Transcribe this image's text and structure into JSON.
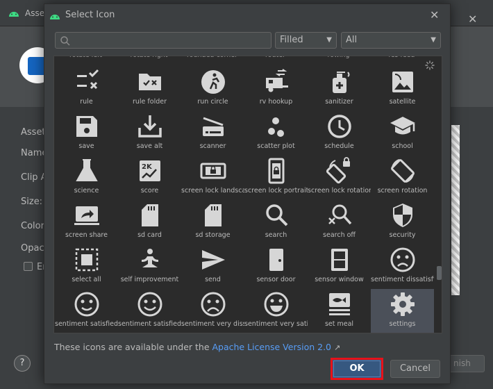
{
  "background_window": {
    "title": "Asse",
    "labels": [
      "Asset",
      "Name",
      "Clip A",
      "Size:",
      "Color:",
      "Opaci",
      "En"
    ],
    "help_label": "?",
    "finish_label": "nish"
  },
  "dialog": {
    "title": "Select Icon",
    "close_label": "✕",
    "search": {
      "value": "",
      "placeholder": ""
    },
    "style_select": {
      "value": "Filled"
    },
    "category_select": {
      "value": "All"
    },
    "partial_row": [
      "rotate left",
      "rotate right",
      "rounded corner",
      "router",
      "rowing",
      "rss feed"
    ],
    "icons": [
      {
        "name": "rule",
        "icon": "rule-icon"
      },
      {
        "name": "rule folder",
        "icon": "rule-folder-icon"
      },
      {
        "name": "run circle",
        "icon": "run-circle-icon"
      },
      {
        "name": "rv hookup",
        "icon": "rv-hookup-icon"
      },
      {
        "name": "sanitizer",
        "icon": "sanitizer-icon"
      },
      {
        "name": "satellite",
        "icon": "satellite-icon"
      },
      {
        "name": "save",
        "icon": "save-icon"
      },
      {
        "name": "save alt",
        "icon": "save-alt-icon"
      },
      {
        "name": "scanner",
        "icon": "scanner-icon"
      },
      {
        "name": "scatter plot",
        "icon": "scatter-plot-icon"
      },
      {
        "name": "schedule",
        "icon": "schedule-icon"
      },
      {
        "name": "school",
        "icon": "school-icon"
      },
      {
        "name": "science",
        "icon": "science-icon"
      },
      {
        "name": "score",
        "icon": "score-icon"
      },
      {
        "name": "screen lock landscape",
        "icon": "screen-lock-landscape-icon"
      },
      {
        "name": "screen lock portrait",
        "icon": "screen-lock-portrait-icon"
      },
      {
        "name": "screen lock rotation",
        "icon": "screen-lock-rotation-icon"
      },
      {
        "name": "screen rotation",
        "icon": "screen-rotation-icon"
      },
      {
        "name": "screen share",
        "icon": "screen-share-icon"
      },
      {
        "name": "sd card",
        "icon": "sd-card-icon"
      },
      {
        "name": "sd storage",
        "icon": "sd-storage-icon"
      },
      {
        "name": "search",
        "icon": "search-icon"
      },
      {
        "name": "search off",
        "icon": "search-off-icon"
      },
      {
        "name": "security",
        "icon": "security-icon"
      },
      {
        "name": "select all",
        "icon": "select-all-icon"
      },
      {
        "name": "self improvement",
        "icon": "self-improvement-icon"
      },
      {
        "name": "send",
        "icon": "send-icon"
      },
      {
        "name": "sensor door",
        "icon": "sensor-door-icon"
      },
      {
        "name": "sensor window",
        "icon": "sensor-window-icon"
      },
      {
        "name": "sentiment dissatisfied",
        "icon": "sentiment-dissatisfied-icon"
      },
      {
        "name": "sentiment satisfied",
        "icon": "sentiment-satisfied-icon"
      },
      {
        "name": "sentiment satisfied alt",
        "icon": "sentiment-satisfied-alt-icon"
      },
      {
        "name": "sentiment very dissatisfied",
        "icon": "sentiment-very-dissatisfied-icon"
      },
      {
        "name": "sentiment very satisfied",
        "icon": "sentiment-very-satisfied-icon"
      },
      {
        "name": "set meal",
        "icon": "set-meal-icon"
      },
      {
        "name": "settings",
        "icon": "settings-icon"
      }
    ],
    "selected_icon": "settings",
    "footer_text": "These icons are available under the ",
    "license_link": "Apache License Version 2.0",
    "license_arrow": "↗",
    "ok_label": "OK",
    "cancel_label": "Cancel"
  },
  "colors": {
    "accent": "#365880",
    "highlight_border": "#e8121a",
    "link": "#589df6",
    "icon": "#d6d6d6"
  }
}
